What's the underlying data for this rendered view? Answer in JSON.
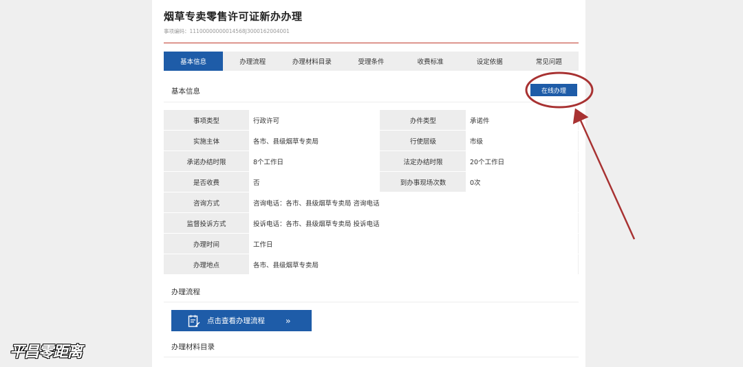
{
  "page": {
    "title": "烟草专卖零售许可证新办办理",
    "code_label": "事项编码：",
    "code_value": "11100000000014568J3000162004001"
  },
  "tabs": [
    {
      "label": "基本信息",
      "active": true
    },
    {
      "label": "办理流程"
    },
    {
      "label": "办理材料目录"
    },
    {
      "label": "受理条件"
    },
    {
      "label": "收费标准"
    },
    {
      "label": "设定依据"
    },
    {
      "label": "常见问题"
    }
  ],
  "basic": {
    "section_title": "基本信息",
    "online_button": "在线办理"
  },
  "info": {
    "r0": {
      "l1": "事项类型",
      "v1": "行政许可",
      "l2": "办件类型",
      "v2": "承诺件"
    },
    "r1": {
      "l1": "实施主体",
      "v1": "各市、县级烟草专卖局",
      "l2": "行使层级",
      "v2": "市级"
    },
    "r2": {
      "l1": "承诺办结时限",
      "v1": "8个工作日",
      "l2": "法定办结时限",
      "v2": "20个工作日"
    },
    "r3": {
      "l1": "是否收费",
      "v1": "否",
      "l2": "到办事现场次数",
      "v2": "0次"
    },
    "r4": {
      "l1": "咨询方式",
      "v1": "咨询电话：各市、县级烟草专卖局 咨询电话"
    },
    "r5": {
      "l1": "监督投诉方式",
      "v1": "投诉电话：各市、县级烟草专卖局 投诉电话"
    },
    "r6": {
      "l1": "办理时间",
      "v1": "工作日"
    },
    "r7": {
      "l1": "办理地点",
      "v1": "各市、县级烟草专卖局"
    }
  },
  "flow": {
    "section_title": "办理流程",
    "button_label": "点击查看办理流程",
    "button_arrows": "››",
    "icon": "document-edit-icon"
  },
  "materials": {
    "section_title": "办理材料目录"
  },
  "watermark": "平昌零距离",
  "colors": {
    "primary": "#1e5ca8",
    "accent_line": "#c0392b",
    "annotation": "#a83232"
  }
}
